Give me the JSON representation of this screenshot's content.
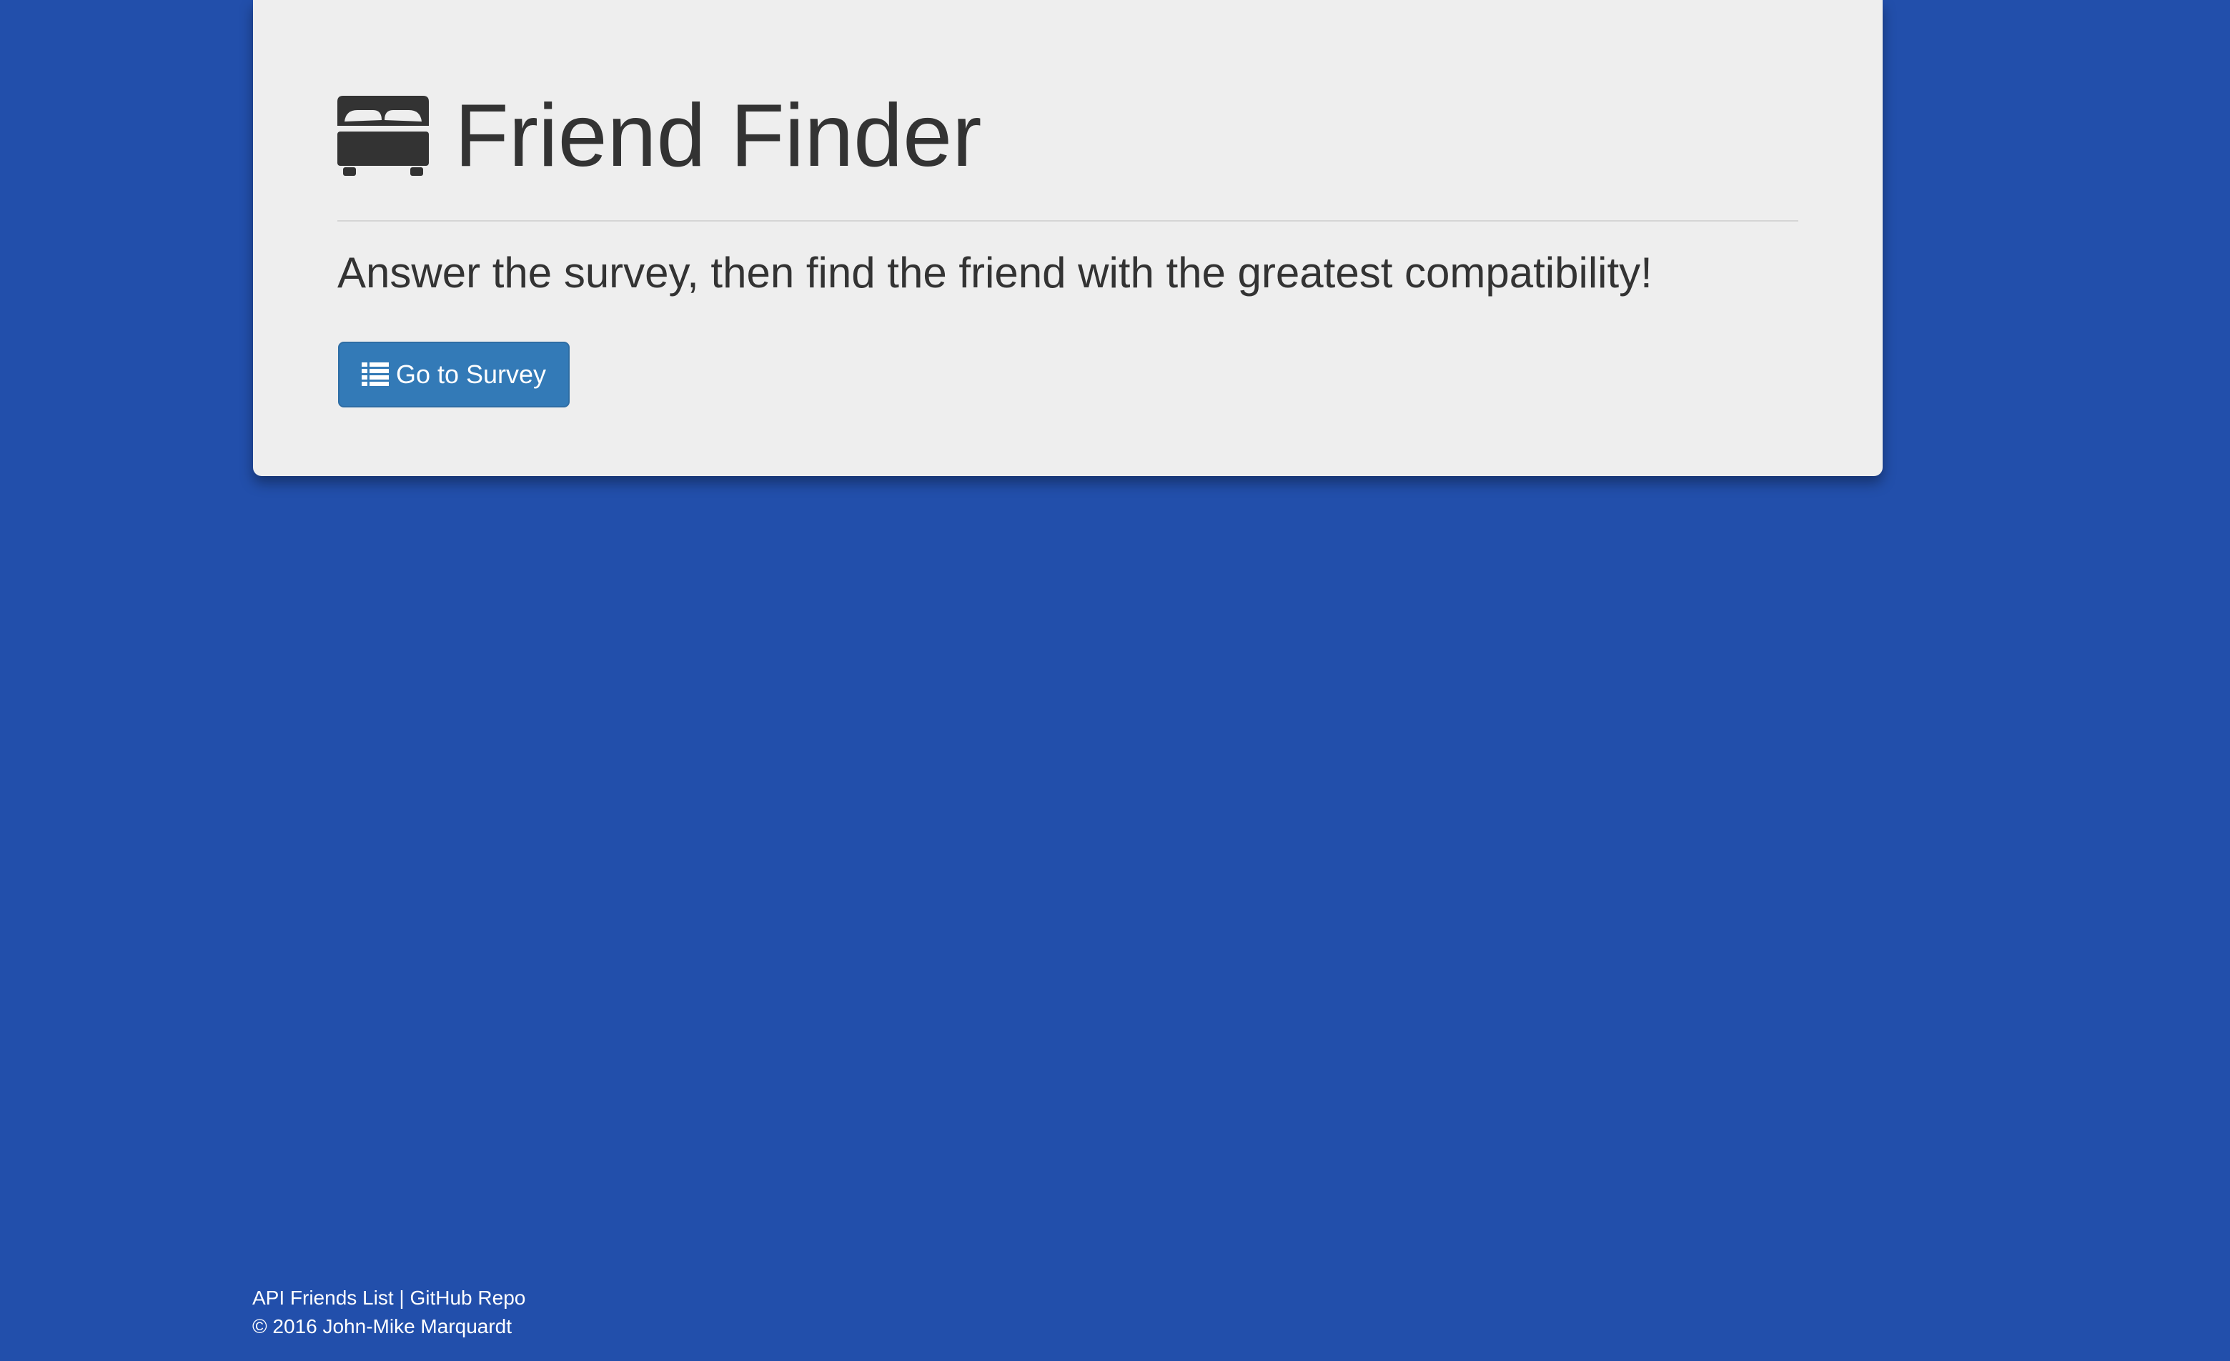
{
  "header": {
    "icon": "bed-icon",
    "title": "Friend Finder"
  },
  "main": {
    "lead": "Answer the survey, then find the friend with the greatest compatibility!",
    "survey_button": {
      "icon": "list-icon",
      "label": "Go to Survey"
    }
  },
  "footer": {
    "api_link": "API Friends List",
    "separator": "|",
    "github_link": "GitHub Repo",
    "copyright": "© 2016 John-Mike Marquardt"
  },
  "colors": {
    "background": "#224fab",
    "panel": "#eeeeee",
    "text": "#333333",
    "button": "#337ab7"
  }
}
